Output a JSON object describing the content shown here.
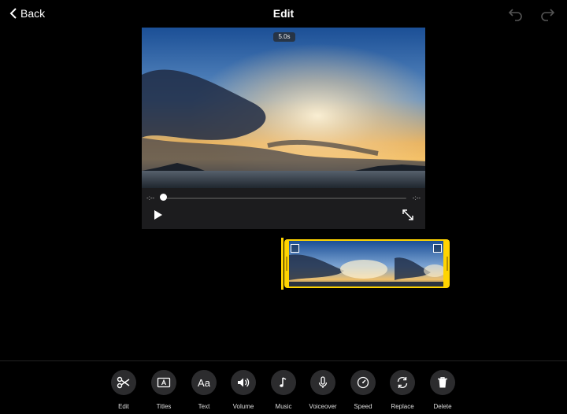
{
  "header": {
    "back_label": "Back",
    "title": "Edit"
  },
  "player": {
    "duration": "5.0s",
    "time_left": "-:--",
    "time_right": "-:--",
    "progress": 0.0
  },
  "toolbar": {
    "items": [
      {
        "label": "Edit",
        "icon": "scissors-icon"
      },
      {
        "label": "Titles",
        "icon": "titles-icon"
      },
      {
        "label": "Text",
        "icon": "text-aa-icon",
        "glyph": "Aa"
      },
      {
        "label": "Volume",
        "icon": "volume-icon"
      },
      {
        "label": "Music",
        "icon": "music-note-icon"
      },
      {
        "label": "Voiceover",
        "icon": "microphone-icon"
      },
      {
        "label": "Speed",
        "icon": "speedometer-icon"
      },
      {
        "label": "Replace",
        "icon": "replace-icon"
      },
      {
        "label": "Delete",
        "icon": "trash-icon"
      }
    ]
  },
  "colors": {
    "accent": "#ffd400",
    "background": "#000000",
    "tool_circle": "#2c2c2e"
  }
}
